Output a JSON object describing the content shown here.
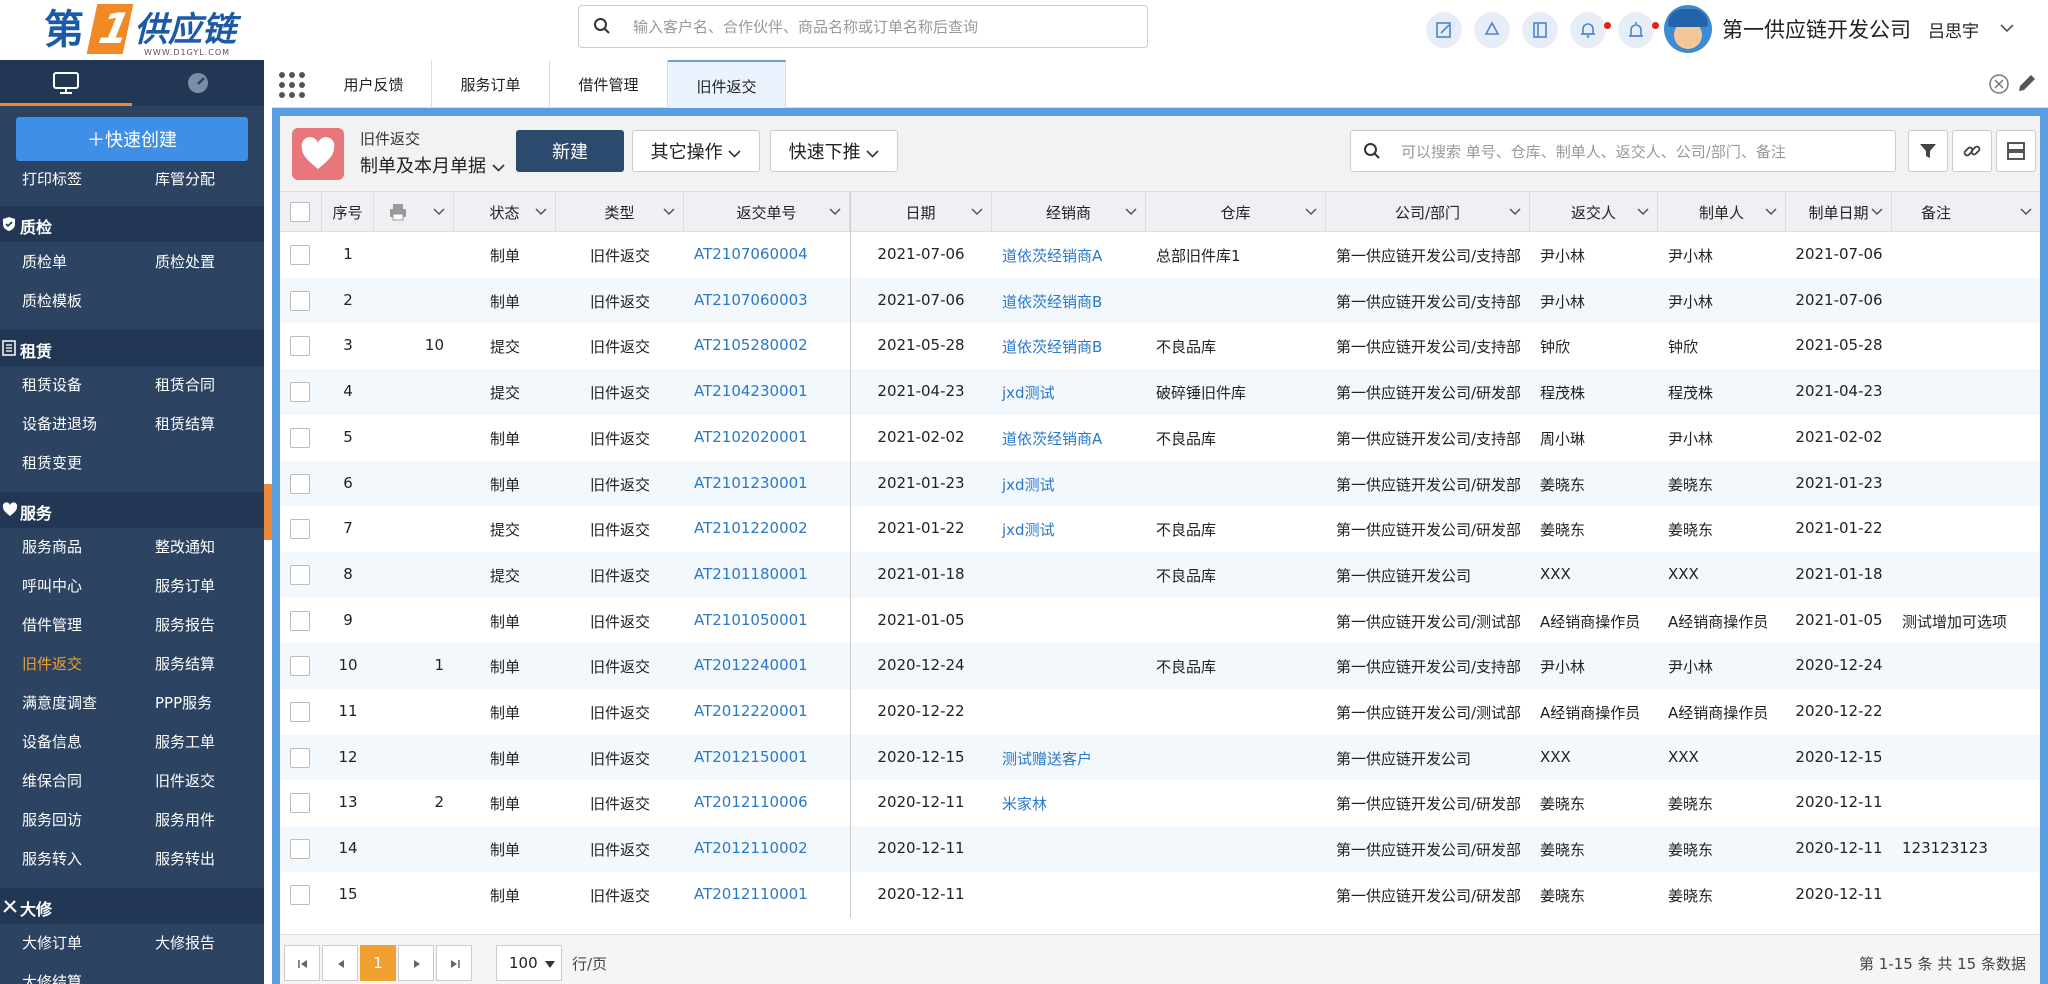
{
  "header": {
    "logo": {
      "big": "第",
      "one": "1",
      "cn": "供应链",
      "url": "WWW.D1GYL.COM"
    },
    "search_placeholder": "输入客户名、合作伙伴、商品名称或订单名称后查询",
    "company": "第一供应链开发公司",
    "username": "吕思宇",
    "icons": [
      "edit-icon",
      "recycle-icon",
      "book-icon",
      "bell-icon",
      "alarm-icon"
    ],
    "accent_color": "#f08a24",
    "brand_color": "#1c5aa8"
  },
  "sidebar": {
    "tabs": [
      "monitor-icon",
      "dashboard-icon"
    ],
    "quick_create": "＋快速创建",
    "menu": {
      "top_row": [
        "打印标签",
        "库管分配"
      ],
      "groups": [
        {
          "title": "质检",
          "icon": "shield-icon",
          "items": [
            "质检单",
            "质检处置",
            "质检模板"
          ]
        },
        {
          "title": "租赁",
          "icon": "lease-icon",
          "items": [
            "租赁设备",
            "租赁合同",
            "设备进退场",
            "租赁结算",
            "租赁变更"
          ]
        },
        {
          "title": "服务",
          "icon": "heart-icon",
          "items": [
            "服务商品",
            "整改通知",
            "呼叫中心",
            "服务订单",
            "借件管理",
            "服务报告",
            "旧件返交",
            "服务结算",
            "满意度调查",
            "PPP服务",
            "设备信息",
            "服务工单",
            "维保合同",
            "旧件返交",
            "服务回访",
            "服务用件",
            "服务转入",
            "服务转出"
          ]
        },
        {
          "title": "大修",
          "icon": "tools-icon",
          "items": [
            "大修订单",
            "大修报告",
            "大修结算"
          ]
        }
      ],
      "active_item": "旧件返交"
    },
    "bg_color": "#2c4361"
  },
  "tabs": [
    "用户反馈",
    "服务订单",
    "借件管理",
    "旧件返交"
  ],
  "active_tab": "旧件返交",
  "toolbar": {
    "title": "旧件返交",
    "filter": "制单及本月单据",
    "new_button": "新建",
    "other_button": "其它操作",
    "push_button": "快速下推",
    "search_placeholder": "可以搜索 单号、仓库、制单人、返交人、公司/部门、备注"
  },
  "table": {
    "columns": [
      "序号",
      "printer-icon",
      "状态",
      "类型",
      "返交单号",
      "日期",
      "经销商",
      "仓库",
      "公司/部门",
      "返交人",
      "制单人",
      "制单日期",
      "备注"
    ],
    "rows": [
      {
        "no": "1",
        "print": "",
        "status": "制单",
        "type": "旧件返交",
        "code": "AT2107060004",
        "date": "2021-07-06",
        "dealer": "道依茨经销商A",
        "warehouse": "总部旧件库1",
        "dept": "第一供应链开发公司/支持部",
        "returner": "尹小林",
        "creator": "尹小林",
        "cdate": "2021-07-06",
        "remark": ""
      },
      {
        "no": "2",
        "print": "",
        "status": "制单",
        "type": "旧件返交",
        "code": "AT2107060003",
        "date": "2021-07-06",
        "dealer": "道依茨经销商B",
        "warehouse": "",
        "dept": "第一供应链开发公司/支持部",
        "returner": "尹小林",
        "creator": "尹小林",
        "cdate": "2021-07-06",
        "remark": ""
      },
      {
        "no": "3",
        "print": "10",
        "status": "提交",
        "type": "旧件返交",
        "code": "AT2105280002",
        "date": "2021-05-28",
        "dealer": "道依茨经销商B",
        "warehouse": "不良品库",
        "dept": "第一供应链开发公司/支持部",
        "returner": "钟欣",
        "creator": "钟欣",
        "cdate": "2021-05-28",
        "remark": ""
      },
      {
        "no": "4",
        "print": "",
        "status": "提交",
        "type": "旧件返交",
        "code": "AT2104230001",
        "date": "2021-04-23",
        "dealer": "jxd测试",
        "warehouse": "破碎锤旧件库",
        "dept": "第一供应链开发公司/研发部",
        "returner": "程茂株",
        "creator": "程茂株",
        "cdate": "2021-04-23",
        "remark": ""
      },
      {
        "no": "5",
        "print": "",
        "status": "制单",
        "type": "旧件返交",
        "code": "AT2102020001",
        "date": "2021-02-02",
        "dealer": "道依茨经销商A",
        "warehouse": "不良品库",
        "dept": "第一供应链开发公司/支持部",
        "returner": "周小琳",
        "creator": "尹小林",
        "cdate": "2021-02-02",
        "remark": ""
      },
      {
        "no": "6",
        "print": "",
        "status": "制单",
        "type": "旧件返交",
        "code": "AT2101230001",
        "date": "2021-01-23",
        "dealer": "jxd测试",
        "warehouse": "",
        "dept": "第一供应链开发公司/研发部",
        "returner": "姜晓东",
        "creator": "姜晓东",
        "cdate": "2021-01-23",
        "remark": ""
      },
      {
        "no": "7",
        "print": "",
        "status": "提交",
        "type": "旧件返交",
        "code": "AT2101220002",
        "date": "2021-01-22",
        "dealer": "jxd测试",
        "warehouse": "不良品库",
        "dept": "第一供应链开发公司/研发部",
        "returner": "姜晓东",
        "creator": "姜晓东",
        "cdate": "2021-01-22",
        "remark": ""
      },
      {
        "no": "8",
        "print": "",
        "status": "提交",
        "type": "旧件返交",
        "code": "AT2101180001",
        "date": "2021-01-18",
        "dealer": "",
        "warehouse": "不良品库",
        "dept": "第一供应链开发公司",
        "returner": "XXX",
        "creator": "XXX",
        "cdate": "2021-01-18",
        "remark": ""
      },
      {
        "no": "9",
        "print": "",
        "status": "制单",
        "type": "旧件返交",
        "code": "AT2101050001",
        "date": "2021-01-05",
        "dealer": "",
        "warehouse": "",
        "dept": "第一供应链开发公司/测试部",
        "returner": "A经销商操作员",
        "creator": "A经销商操作员",
        "cdate": "2021-01-05",
        "remark": "测试增加可选项"
      },
      {
        "no": "10",
        "print": "1",
        "status": "制单",
        "type": "旧件返交",
        "code": "AT2012240001",
        "date": "2020-12-24",
        "dealer": "",
        "warehouse": "不良品库",
        "dept": "第一供应链开发公司/支持部",
        "returner": "尹小林",
        "creator": "尹小林",
        "cdate": "2020-12-24",
        "remark": ""
      },
      {
        "no": "11",
        "print": "",
        "status": "制单",
        "type": "旧件返交",
        "code": "AT2012220001",
        "date": "2020-12-22",
        "dealer": "",
        "warehouse": "",
        "dept": "第一供应链开发公司/测试部",
        "returner": "A经销商操作员",
        "creator": "A经销商操作员",
        "cdate": "2020-12-22",
        "remark": ""
      },
      {
        "no": "12",
        "print": "",
        "status": "制单",
        "type": "旧件返交",
        "code": "AT2012150001",
        "date": "2020-12-15",
        "dealer": "测试赠送客户",
        "warehouse": "",
        "dept": "第一供应链开发公司",
        "returner": "XXX",
        "creator": "XXX",
        "cdate": "2020-12-15",
        "remark": ""
      },
      {
        "no": "13",
        "print": "2",
        "status": "制单",
        "type": "旧件返交",
        "code": "AT2012110006",
        "date": "2020-12-11",
        "dealer": "米家林",
        "warehouse": "",
        "dept": "第一供应链开发公司/研发部",
        "returner": "姜晓东",
        "creator": "姜晓东",
        "cdate": "2020-12-11",
        "remark": ""
      },
      {
        "no": "14",
        "print": "",
        "status": "制单",
        "type": "旧件返交",
        "code": "AT2012110002",
        "date": "2020-12-11",
        "dealer": "",
        "warehouse": "",
        "dept": "第一供应链开发公司/研发部",
        "returner": "姜晓东",
        "creator": "姜晓东",
        "cdate": "2020-12-11",
        "remark": "123123123"
      },
      {
        "no": "15",
        "print": "",
        "status": "制单",
        "type": "旧件返交",
        "code": "AT2012110001",
        "date": "2020-12-11",
        "dealer": "",
        "warehouse": "",
        "dept": "第一供应链开发公司/研发部",
        "returner": "姜晓东",
        "creator": "姜晓东",
        "cdate": "2020-12-11",
        "remark": ""
      }
    ]
  },
  "footer": {
    "current_page": "1",
    "page_size": "100",
    "per_page_label": "行/页",
    "info": "第 1-15 条 共 15 条数据"
  }
}
